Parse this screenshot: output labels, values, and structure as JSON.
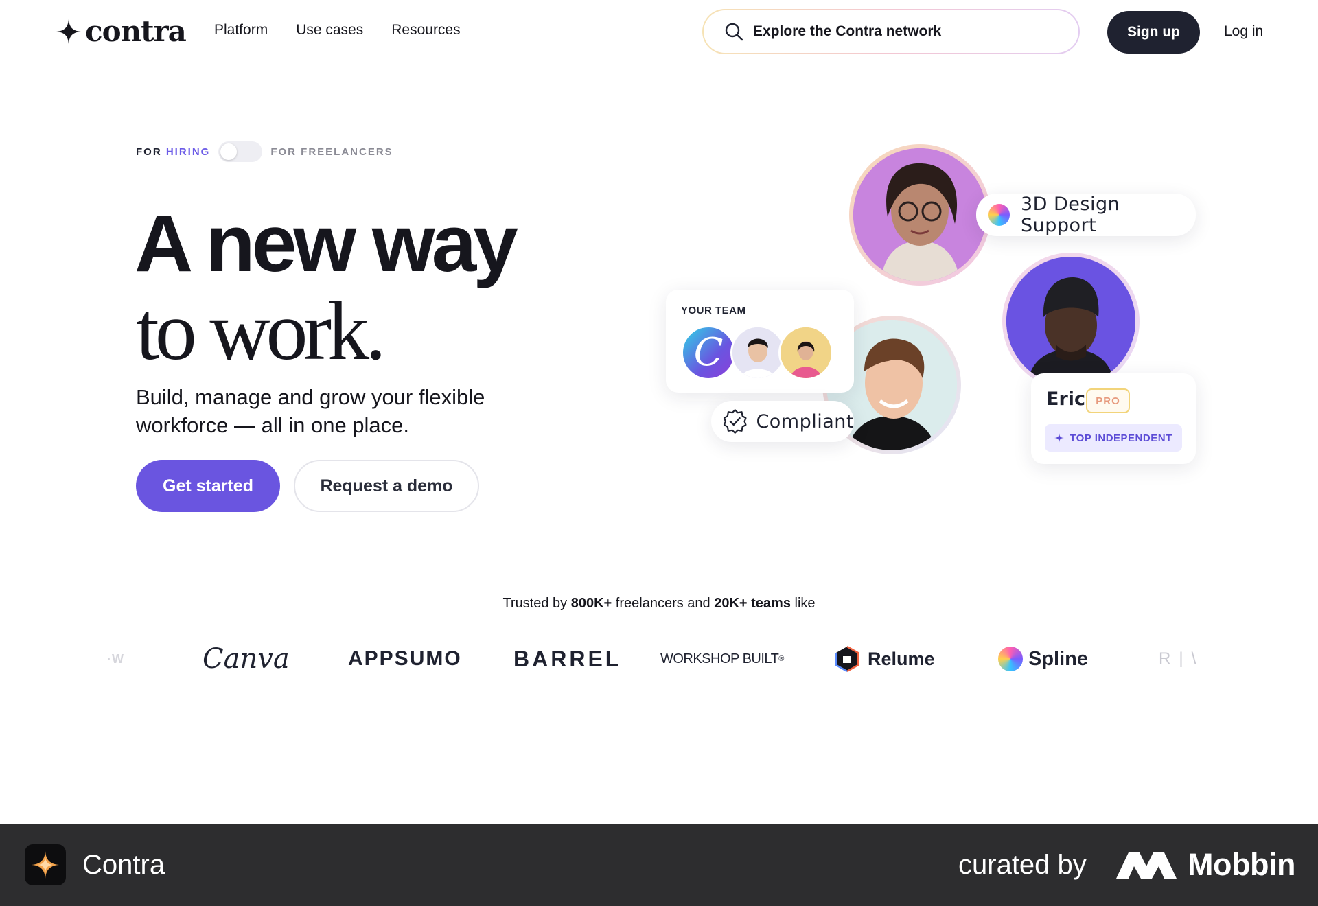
{
  "nav": {
    "logo_text": "contra",
    "links": [
      "Platform",
      "Use cases",
      "Resources"
    ],
    "search_placeholder": "Explore the Contra network",
    "signup_label": "Sign up",
    "login_label": "Log in"
  },
  "hero": {
    "toggle_left_prefix": "FOR ",
    "toggle_left_highlight": "HIRING",
    "toggle_right": "FOR FREELANCERS",
    "headline_line1": "A new way",
    "headline_line2": "to work.",
    "subhead": "Build, manage and grow your flexible workforce — all in one place.",
    "cta_primary": "Get started",
    "cta_secondary": "Request a demo"
  },
  "showcase": {
    "skill_pill": "3D Design Support",
    "team_label": "YOUR TEAM",
    "compliant_label": "Compliant",
    "profile_name": "Eric",
    "profile_badge": "PRO",
    "profile_tag": "TOP INDEPENDENT"
  },
  "trusted": {
    "prefix": "Trusted by ",
    "freelancers_count": "800K+",
    "middle": " freelancers and ",
    "teams_count": "20K+ teams",
    "suffix": " like"
  },
  "brands": [
    "Canva",
    "APPSUMO",
    "BARREL",
    "WORKSHOP BUILT",
    "Relume",
    "Spline"
  ],
  "footer": {
    "app_name": "Contra",
    "curated_by": "curated by",
    "curator": "Mobbin"
  },
  "colors": {
    "accent": "#6a55e0",
    "dark": "#1f2230",
    "footer_bg": "#2d2d2f"
  }
}
